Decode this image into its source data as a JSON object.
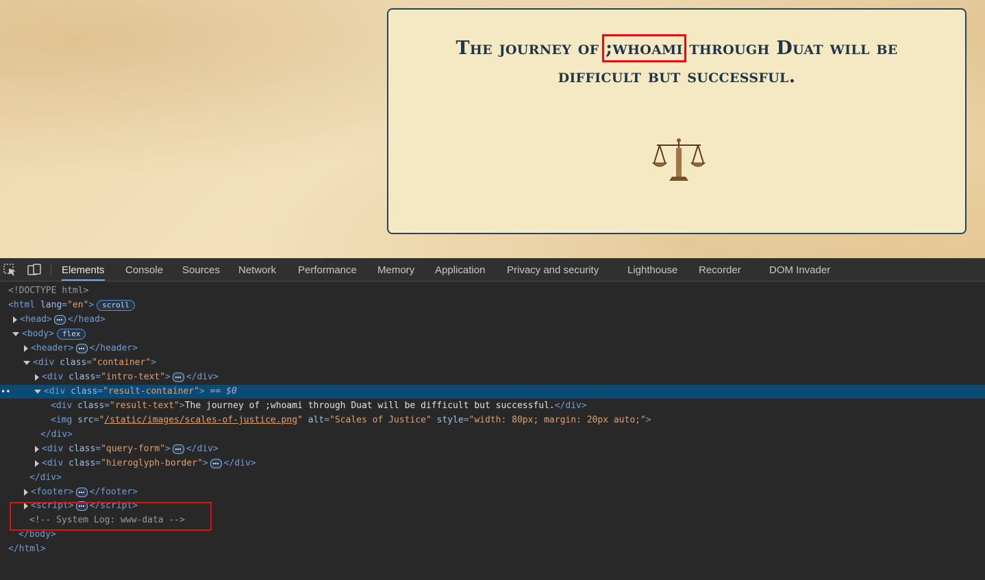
{
  "page": {
    "result_pre": "The journey of ",
    "result_highlight": ";whoami",
    "result_post": " through Duat will be difficult but successful.",
    "scales_alt": "Scales of Justice"
  },
  "devtools": {
    "tabs": [
      "Elements",
      "Console",
      "Sources",
      "Network",
      "Performance",
      "Memory",
      "Application",
      "Privacy and security",
      "Lighthouse",
      "Recorder",
      "DOM Invader"
    ],
    "active_tab": "Elements",
    "dom": {
      "doctype": "<!DOCTYPE html>",
      "html_open": "<html",
      "lang_attr": "lang",
      "lang_val": "\"en\"",
      "scroll_badge": "scroll",
      "flex_badge": "flex",
      "head": "head",
      "body": "body",
      "header": "header",
      "div": "div",
      "class_attr": "class",
      "container_val": "\"container\"",
      "intro_val": "\"intro-text\"",
      "result_container_val": "\"result-container\"",
      "selected_marker": "== $0",
      "result_text_val": "\"result-text\"",
      "result_text_content": "The journey of ;whoami through Duat will be difficult but successful.",
      "img": "img",
      "src_attr": "src",
      "src_val": "/static/images/scales-of-justice.png",
      "alt_attr": "alt",
      "alt_val": "\"Scales of Justice\"",
      "style_attr": "style",
      "style_val": "\"width: 80px; margin: 20px auto;\"",
      "query_val": "\"query-form\"",
      "hiero_val": "\"hieroglyph-border\"",
      "footer": "footer",
      "script": "script",
      "comment": "<!-- System Log: www-data -->",
      "html_close": "</html>"
    }
  }
}
